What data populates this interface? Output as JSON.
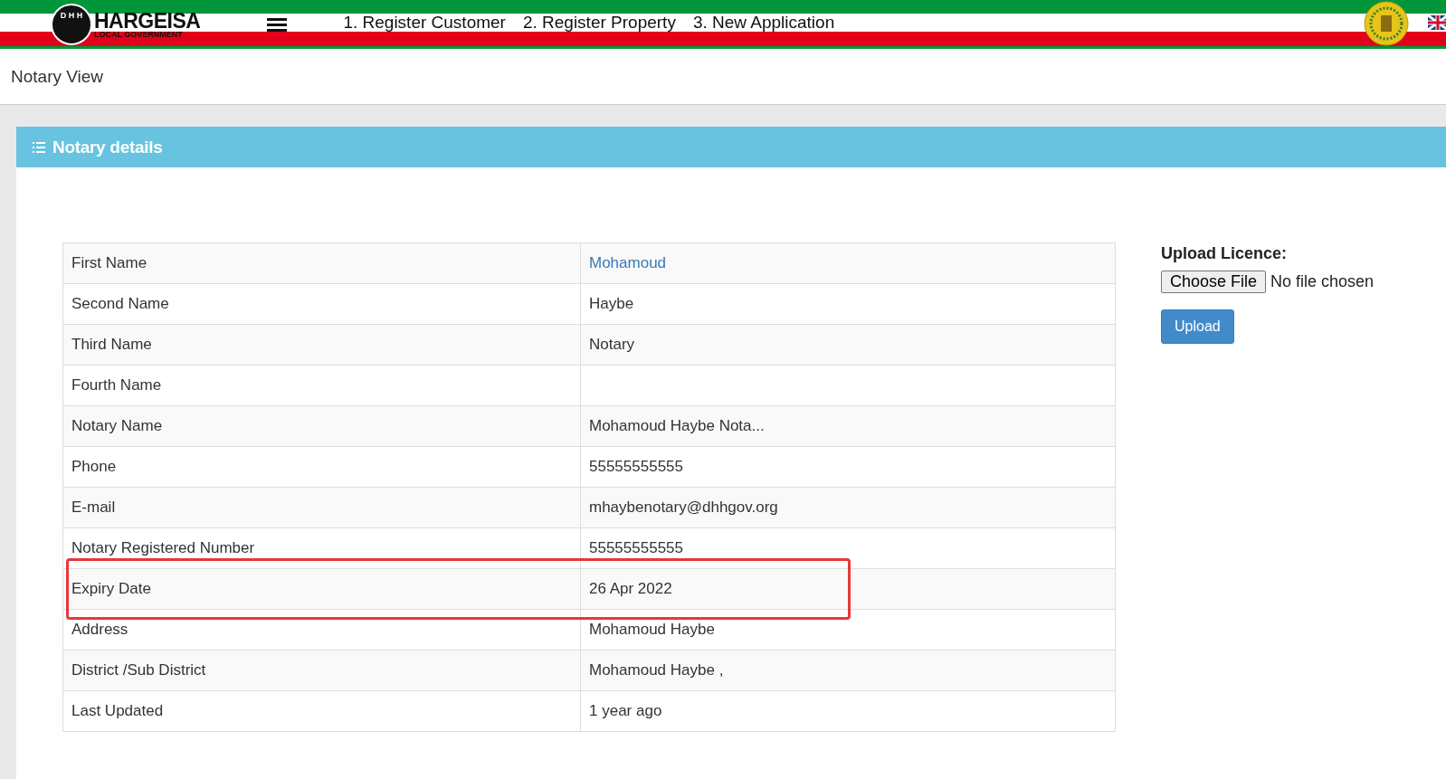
{
  "header": {
    "logo": {
      "initials": "D H H",
      "name": "HARGEISA",
      "subtitle": "LOCAL GOVERNMENT"
    },
    "nav": [
      "1. Register Customer",
      "2. Register Property",
      "3. New Application"
    ]
  },
  "page_title": "Notary View",
  "panel": {
    "title": "Notary details",
    "rows": [
      {
        "label": "First Name",
        "value": "Mohamoud",
        "kind": "link"
      },
      {
        "label": "Second Name",
        "value": "Haybe",
        "kind": "text"
      },
      {
        "label": "Third Name",
        "value": "Notary",
        "kind": "text"
      },
      {
        "label": "Fourth Name"
      },
      {
        "label": "Notary Name",
        "value": "Mohamoud Haybe Nota...",
        "kind": "text"
      },
      {
        "label": "Phone",
        "value": "55555555555",
        "kind": "text"
      },
      {
        "label": "E-mail",
        "value": "mhaybenotary@dhhgov.org",
        "kind": "text"
      },
      {
        "label": "Notary Registered Number",
        "value": "55555555555",
        "kind": "text"
      },
      {
        "label": "Expiry Date",
        "value": "26 Apr 2022",
        "kind": "text",
        "highlighted": true
      },
      {
        "label": "Address",
        "value": "Mohamoud Haybe",
        "kind": "text"
      },
      {
        "label": "District /Sub District",
        "value": "Mohamoud Haybe ,",
        "kind": "text"
      },
      {
        "label": "Last Updated",
        "value": "1 year ago",
        "kind": "text"
      }
    ],
    "upload": {
      "label": "Upload Licence:",
      "choose_button": "Choose File",
      "file_status": "No file chosen",
      "button": "Upload"
    }
  }
}
